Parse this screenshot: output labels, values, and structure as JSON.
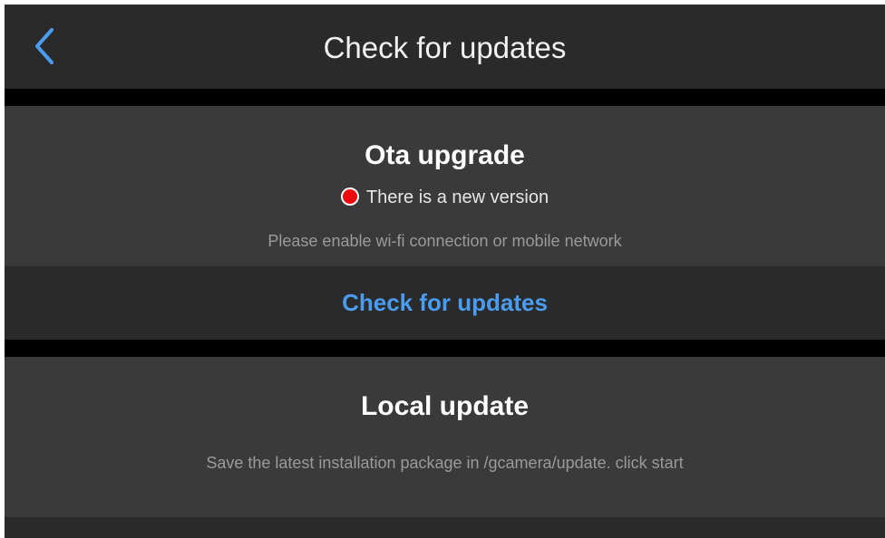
{
  "header": {
    "back_icon": "chevron-left-icon",
    "title": "Check for updates"
  },
  "ota": {
    "title": "Ota upgrade",
    "status_text": "There is a new version",
    "status_color": "#ee0a0a",
    "hint": "Please enable wi-fi connection or mobile network",
    "action_label": "Check for updates"
  },
  "local": {
    "title": "Local update",
    "hint": "Save the latest installation package in /gcamera/update. click start"
  },
  "colors": {
    "accent": "#4a9cf0",
    "header_bg": "#2a2a2a",
    "card_bg": "#3a3a3a",
    "page_bg": "#000000"
  }
}
